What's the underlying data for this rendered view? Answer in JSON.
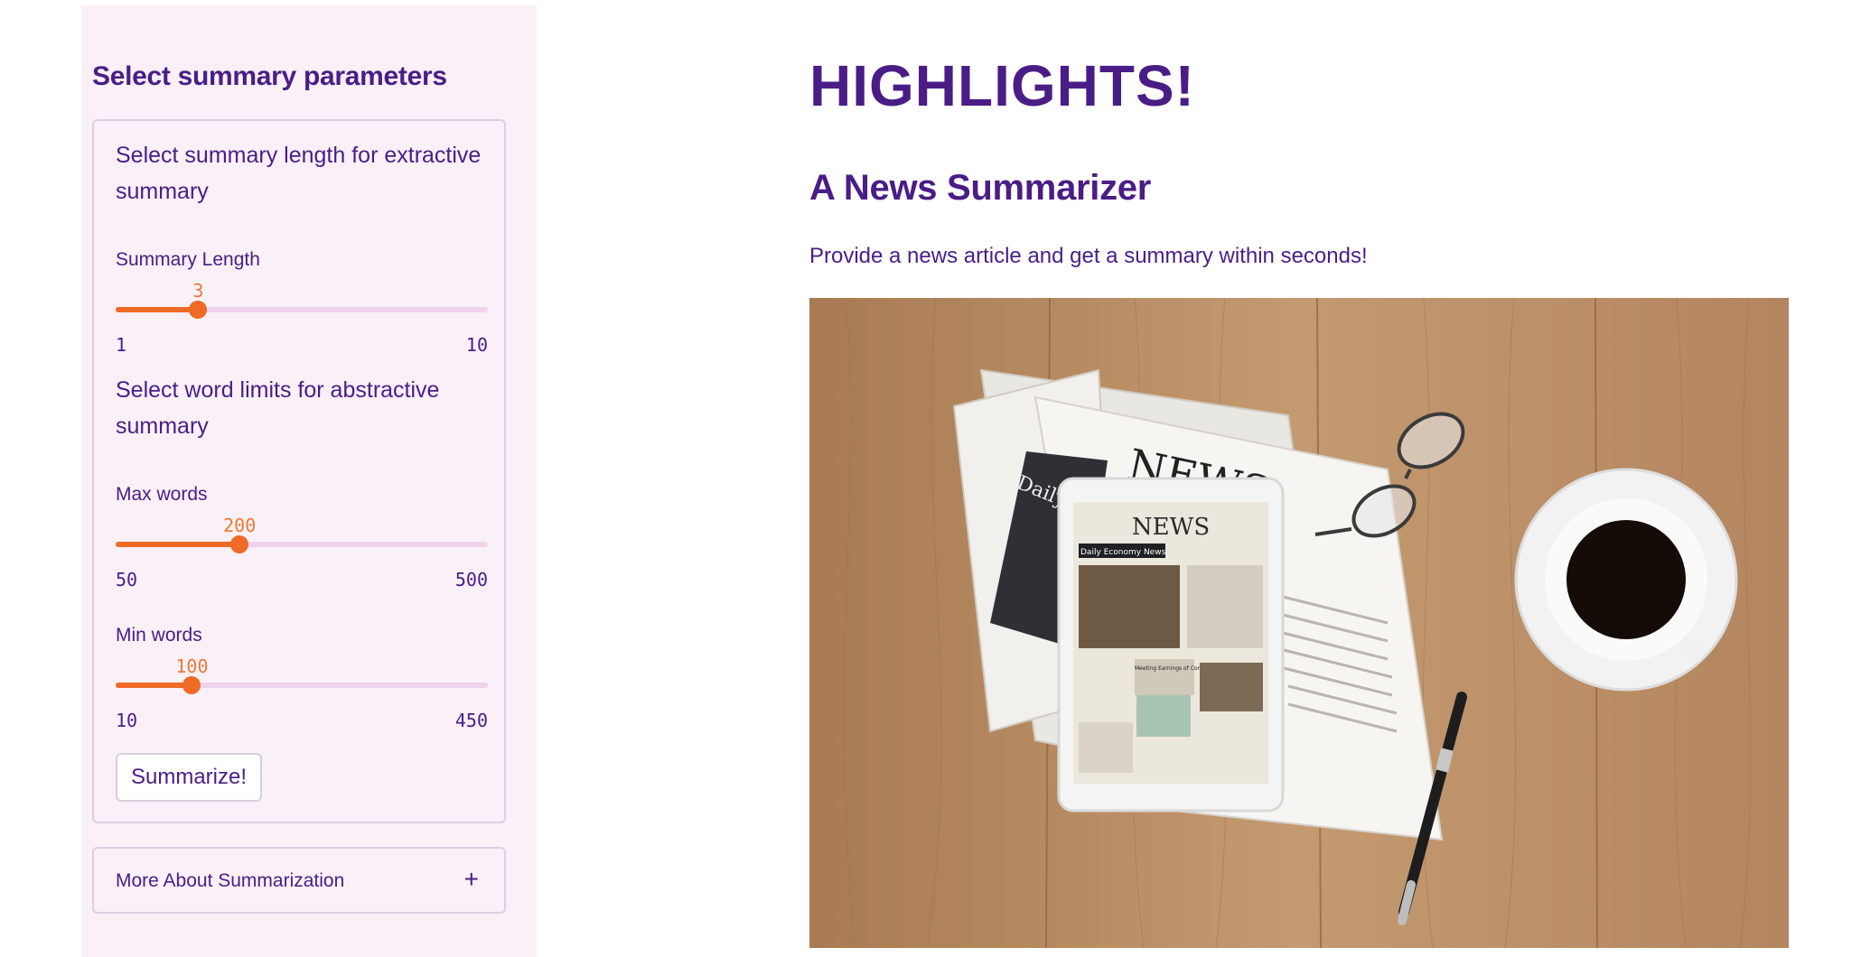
{
  "sidebar": {
    "title": "Select summary parameters",
    "extractive_heading": "Select summary length for extractive summary",
    "abstractive_heading": "Select word limits for abstractive summary",
    "sliders": [
      {
        "label": "Summary Length",
        "value": "3",
        "min": "1",
        "max": "10",
        "fraction": 0.222
      },
      {
        "label": "Max words",
        "value": "200",
        "min": "50",
        "max": "500",
        "fraction": 0.333
      },
      {
        "label": "Min words",
        "value": "100",
        "min": "10",
        "max": "450",
        "fraction": 0.205
      }
    ],
    "submit_label": "Summarize!",
    "expander_label": "More About Summarization",
    "expander_icon": "plus-icon",
    "expander_glyph": "+"
  },
  "main": {
    "title": "HIGHLIGHTS!",
    "subtitle": "A News Summarizer",
    "description": "Provide a news article and get a summary within seconds!",
    "image": {
      "newspaper_masthead": "NEWS",
      "tablet_banner": "Daily Economy News",
      "tablet_article_heading": "Meeting Earnings of Companies",
      "paper_banner": "Daily Eco"
    }
  },
  "colors": {
    "text": "#4a1d86",
    "accent": "#ee6a25",
    "slider_track": "#f0d2ec",
    "sidebar_bg": "#f9f0f8"
  }
}
